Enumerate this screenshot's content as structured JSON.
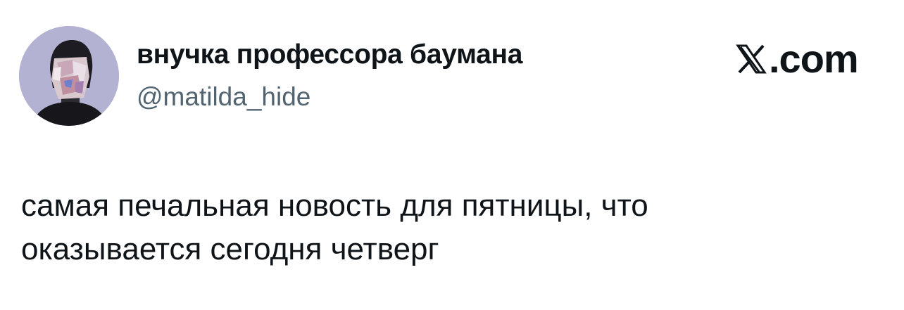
{
  "author": {
    "display_name": "внучка профессора баумана",
    "handle": "@matilda_hide"
  },
  "brand": {
    "label": ".com",
    "icon": "x-logo-icon"
  },
  "tweet": {
    "lines": [
      "самая печальная новость для пятницы, что",
      "оказывается сегодня четверг"
    ]
  },
  "colors": {
    "text": "#0f1419",
    "handle": "#536471",
    "avatar_bg": "#b3b2d2"
  }
}
